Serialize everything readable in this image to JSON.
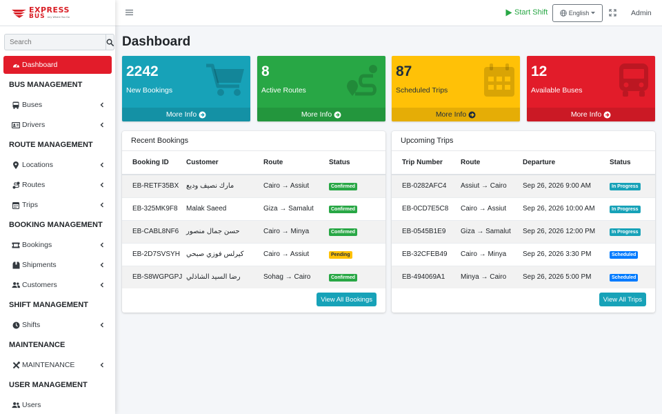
{
  "brand": {
    "line1": "EXPRESS",
    "line2": "BUS",
    "tagline": "Any Where You Go"
  },
  "search": {
    "placeholder": "Search"
  },
  "sidebar": {
    "dashboard": "Dashboard",
    "sections": {
      "bus": "BUS MANAGEMENT",
      "route": "ROUTE MANAGEMENT",
      "booking": "BOOKING MANAGEMENT",
      "shift": "SHIFT MANAGEMENT",
      "maintenance": "MAINTENANCE",
      "user": "USER MANAGEMENT"
    },
    "items": {
      "buses": "Buses",
      "drivers": "Drivers",
      "locations": "Locations",
      "routes": "Routes",
      "trips": "Trips",
      "bookings": "Bookings",
      "shipments": "Shipments",
      "customers": "Customers",
      "shifts": "Shifts",
      "maintenance": "MAINTENANCE",
      "users": "Users"
    }
  },
  "topbar": {
    "start_shift": "Start Shift",
    "language": "English",
    "user": "Admin"
  },
  "page": {
    "title": "Dashboard"
  },
  "stats": [
    {
      "value": "2242",
      "label": "New Bookings",
      "more": "More Info",
      "color": "#17a2b8",
      "icon": "cart-icon"
    },
    {
      "value": "8",
      "label": "Active Routes",
      "more": "More Info",
      "color": "#28a745",
      "icon": "route-icon"
    },
    {
      "value": "87",
      "label": "Scheduled Trips",
      "more": "More Info",
      "color": "#ffc107",
      "icon": "calendar-icon"
    },
    {
      "value": "12",
      "label": "Available Buses",
      "more": "More Info",
      "color": "#e21c2a",
      "icon": "bus-icon"
    }
  ],
  "recent_bookings": {
    "title": "Recent Bookings",
    "columns": [
      "Booking ID",
      "Customer",
      "Route",
      "Status"
    ],
    "rows": [
      {
        "id": "EB-RETF35BX",
        "customer": "مارك نصيف وديع",
        "route": "Cairo → Assiut",
        "status": "Confirmed"
      },
      {
        "id": "EB-325MK9F8",
        "customer": "Malak Saeed",
        "route": "Giza → Samalut",
        "status": "Confirmed"
      },
      {
        "id": "EB-CABL8NF6",
        "customer": "حسن جمال منصور",
        "route": "Cairo → Minya",
        "status": "Confirmed"
      },
      {
        "id": "EB-2D7SVSYH",
        "customer": "كيرلس فوزي صبحي",
        "route": "Cairo → Assiut",
        "status": "Pending"
      },
      {
        "id": "EB-S8WGPGPJ",
        "customer": "رضا السيد الشاذلي",
        "route": "Sohag → Cairo",
        "status": "Confirmed"
      }
    ],
    "button": "View All Bookings"
  },
  "upcoming_trips": {
    "title": "Upcoming Trips",
    "columns": [
      "Trip Number",
      "Route",
      "Departure",
      "Status"
    ],
    "rows": [
      {
        "id": "EB-0282AFC4",
        "route": "Assiut → Cairo",
        "departure": "Sep 26, 2026 9:00 AM",
        "status": "In Progress"
      },
      {
        "id": "EB-0CD7E5C8",
        "route": "Cairo → Assiut",
        "departure": "Sep 26, 2026 10:00 AM",
        "status": "In Progress"
      },
      {
        "id": "EB-0545B1E9",
        "route": "Giza → Samalut",
        "departure": "Sep 26, 2026 12:00 PM",
        "status": "In Progress"
      },
      {
        "id": "EB-32CFEB49",
        "route": "Cairo → Minya",
        "departure": "Sep 26, 2026 3:30 PM",
        "status": "Scheduled"
      },
      {
        "id": "EB-494069A1",
        "route": "Minya → Cairo",
        "departure": "Sep 26, 2026 5:00 PM",
        "status": "Scheduled"
      }
    ],
    "button": "View All Trips"
  },
  "colors": {
    "brand_red": "#e21c2a",
    "success": "#28a745",
    "info": "#17a2b8",
    "warning": "#ffc107",
    "primary": "#007bff"
  }
}
